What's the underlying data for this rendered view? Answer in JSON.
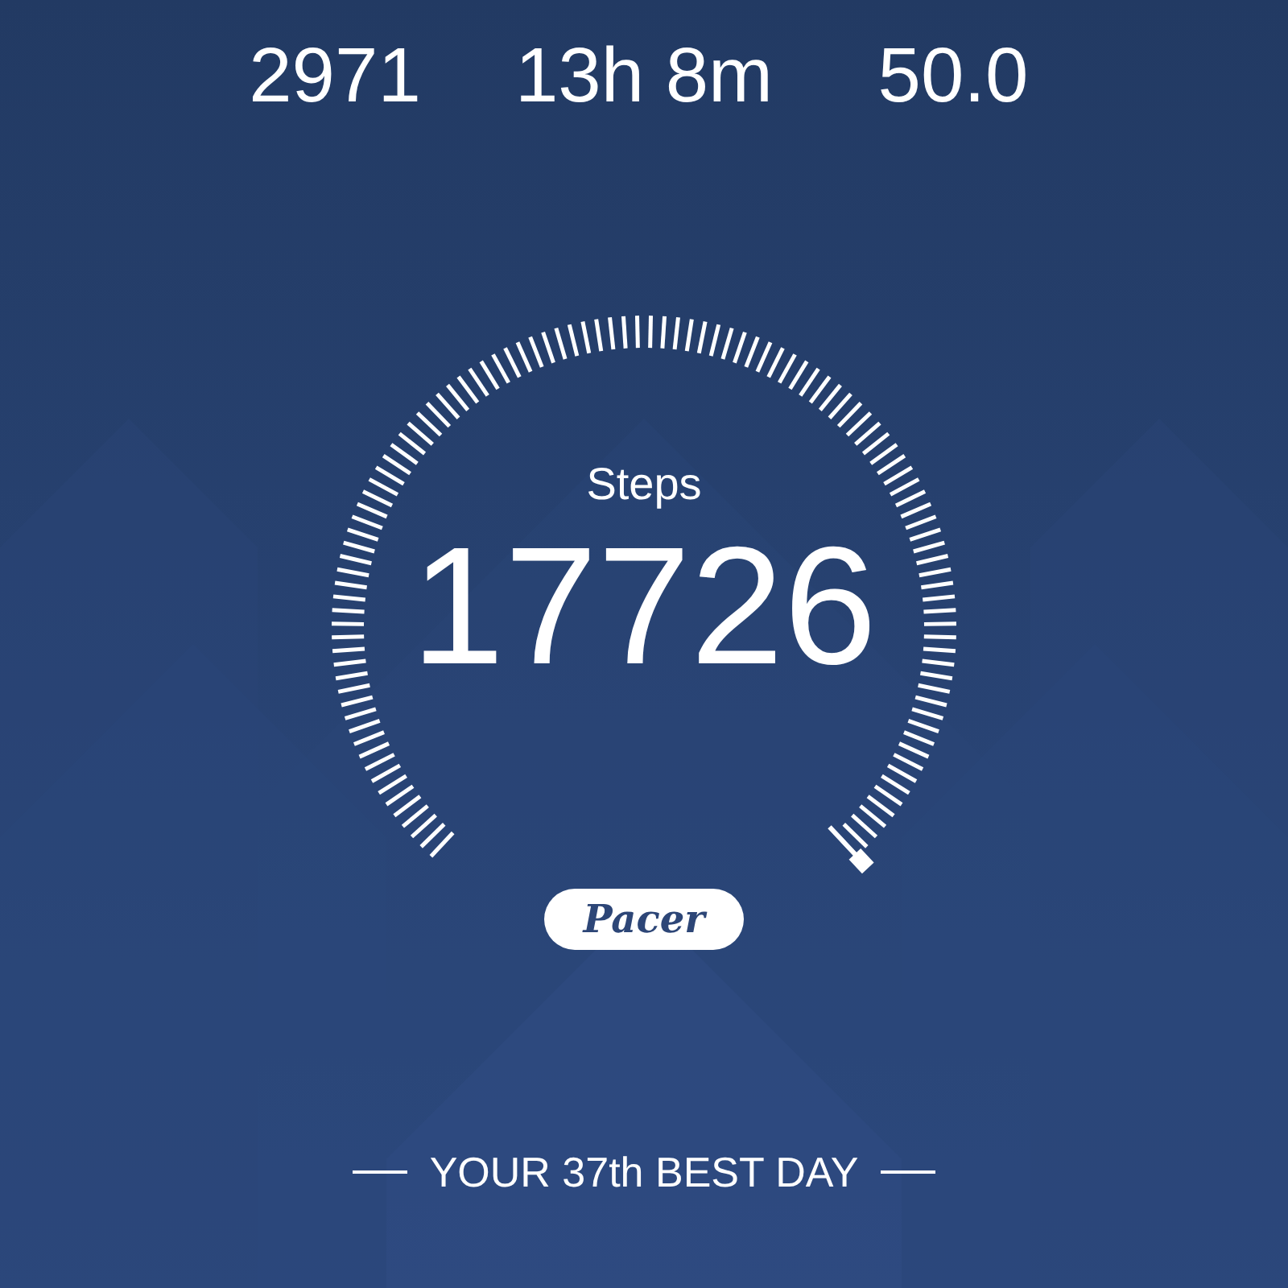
{
  "stats": [
    {
      "value": "2971"
    },
    {
      "value": "13h 8m"
    },
    {
      "value": "50.0"
    }
  ],
  "gauge": {
    "label": "Steps",
    "value": "17726"
  },
  "badge": "Pacer",
  "rank": "YOUR 37th BEST DAY"
}
